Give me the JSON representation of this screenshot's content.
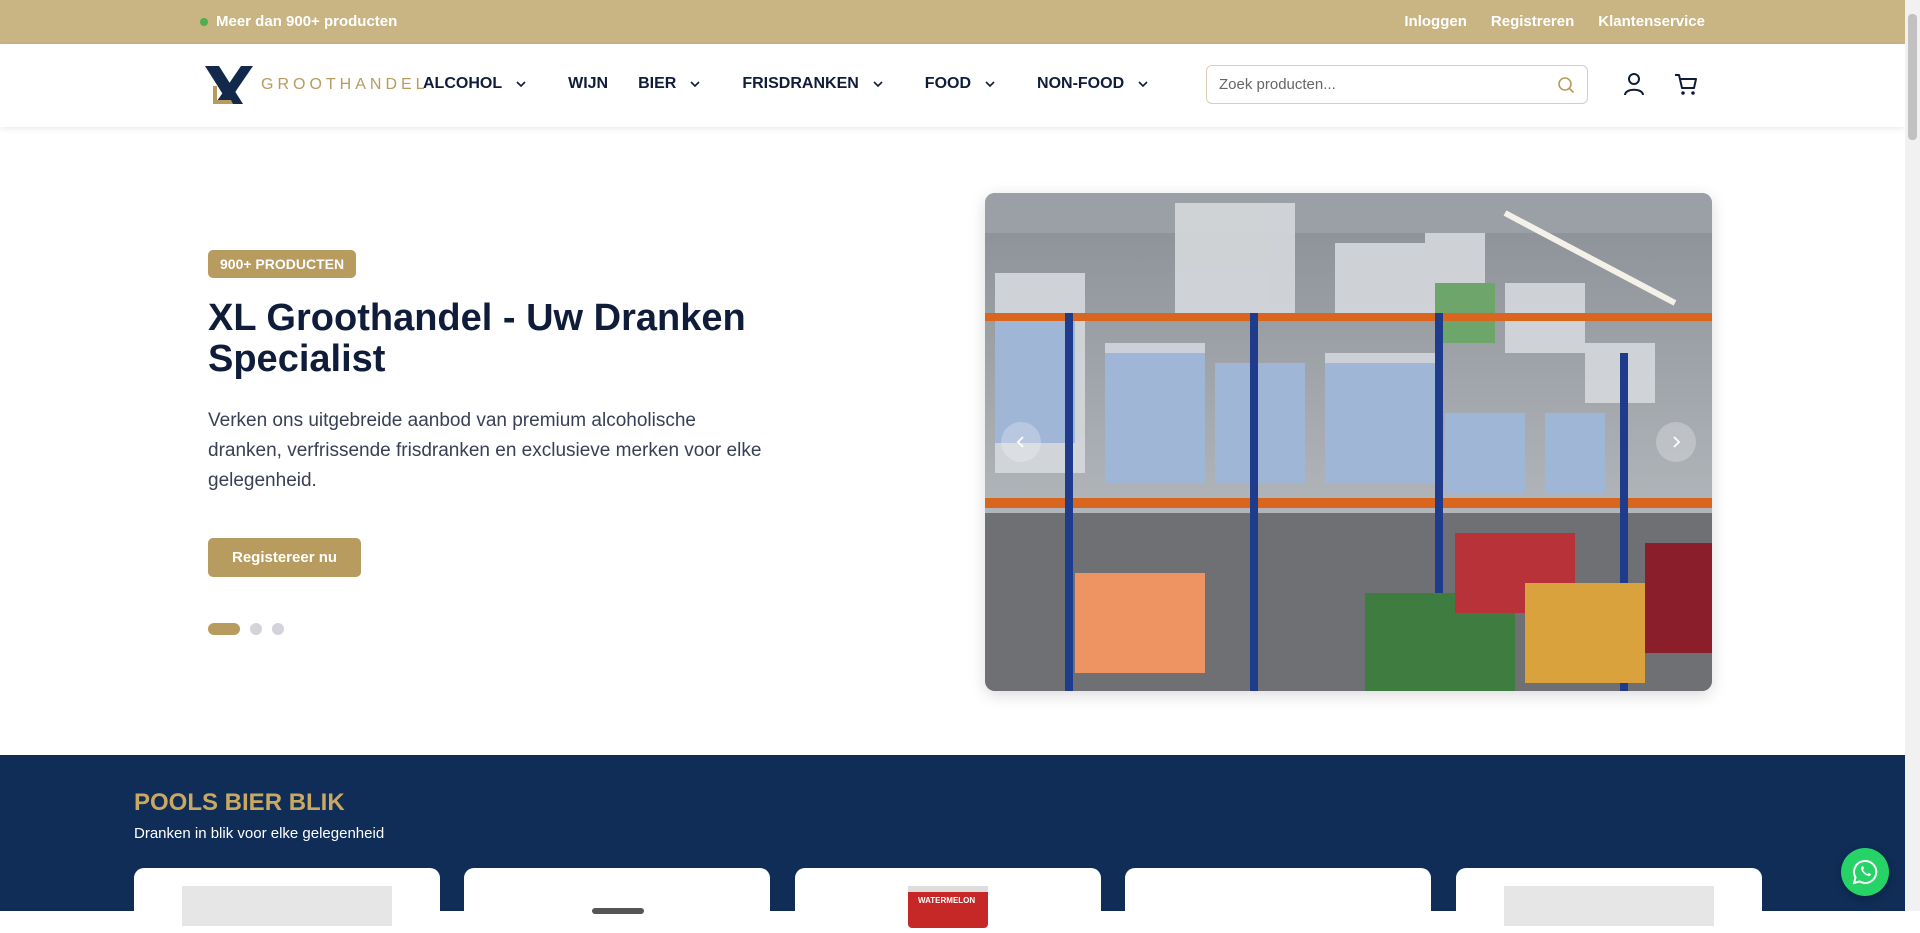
{
  "topbar": {
    "promo": "Meer dan 900+ producten",
    "links": [
      "Inloggen",
      "Registreren",
      "Klantenservice"
    ]
  },
  "logo": {
    "text": "GROOTHANDEL"
  },
  "nav": {
    "items": [
      {
        "label": "ALCOHOL",
        "dropdown": true
      },
      {
        "label": "WIJN",
        "dropdown": false
      },
      {
        "label": "BIER",
        "dropdown": true
      },
      {
        "label": "FRISDRANKEN",
        "dropdown": true
      },
      {
        "label": "FOOD",
        "dropdown": true
      },
      {
        "label": "NON-FOOD",
        "dropdown": true
      }
    ]
  },
  "search": {
    "placeholder": "Zoek producten..."
  },
  "hero": {
    "badge": "900+ PRODUCTEN",
    "title": "XL Groothandel - Uw Dranken Specialist",
    "description": "Verken ons uitgebreide aanbod van premium alcoholische dranken, verfrissende frisdranken en exclusieve merken voor elke gelegenheid.",
    "cta": "Registereer nu",
    "slides_total": 3,
    "active_slide": 1
  },
  "section": {
    "title": "POOLS BIER BLIK",
    "subtitle": "Dranken in blik voor elke gelegenheid",
    "card_label": "WATERMELON"
  },
  "colors": {
    "gold": "#c9b483",
    "accent": "#b89b5e",
    "navy": "#0f2d57",
    "whatsapp": "#25d366"
  },
  "icons": [
    "search-icon",
    "user-icon",
    "cart-icon",
    "chevron-left-icon",
    "chevron-right-icon",
    "whatsapp-icon"
  ]
}
